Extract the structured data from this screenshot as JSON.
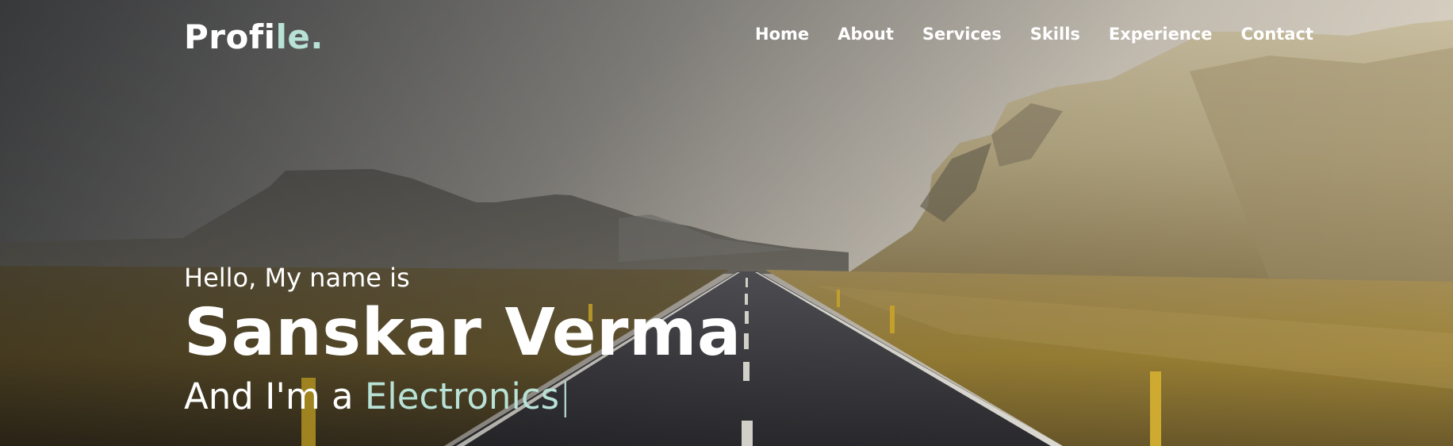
{
  "brand": {
    "logo_main": "Profi",
    "logo_accent": "le."
  },
  "nav": {
    "items": [
      "Home",
      "About",
      "Services",
      "Skills",
      "Experience",
      "Contact"
    ]
  },
  "hero": {
    "greeting": "Hello, My name is",
    "name": "Sanskar Verma",
    "role_prefix": "And I'm a ",
    "role_typed": "Electronics",
    "cursor": "|"
  },
  "colors": {
    "accent": "#b8e2d6",
    "text": "#ffffff"
  },
  "icons": {
    "background": "mountain-road-landscape-image"
  }
}
